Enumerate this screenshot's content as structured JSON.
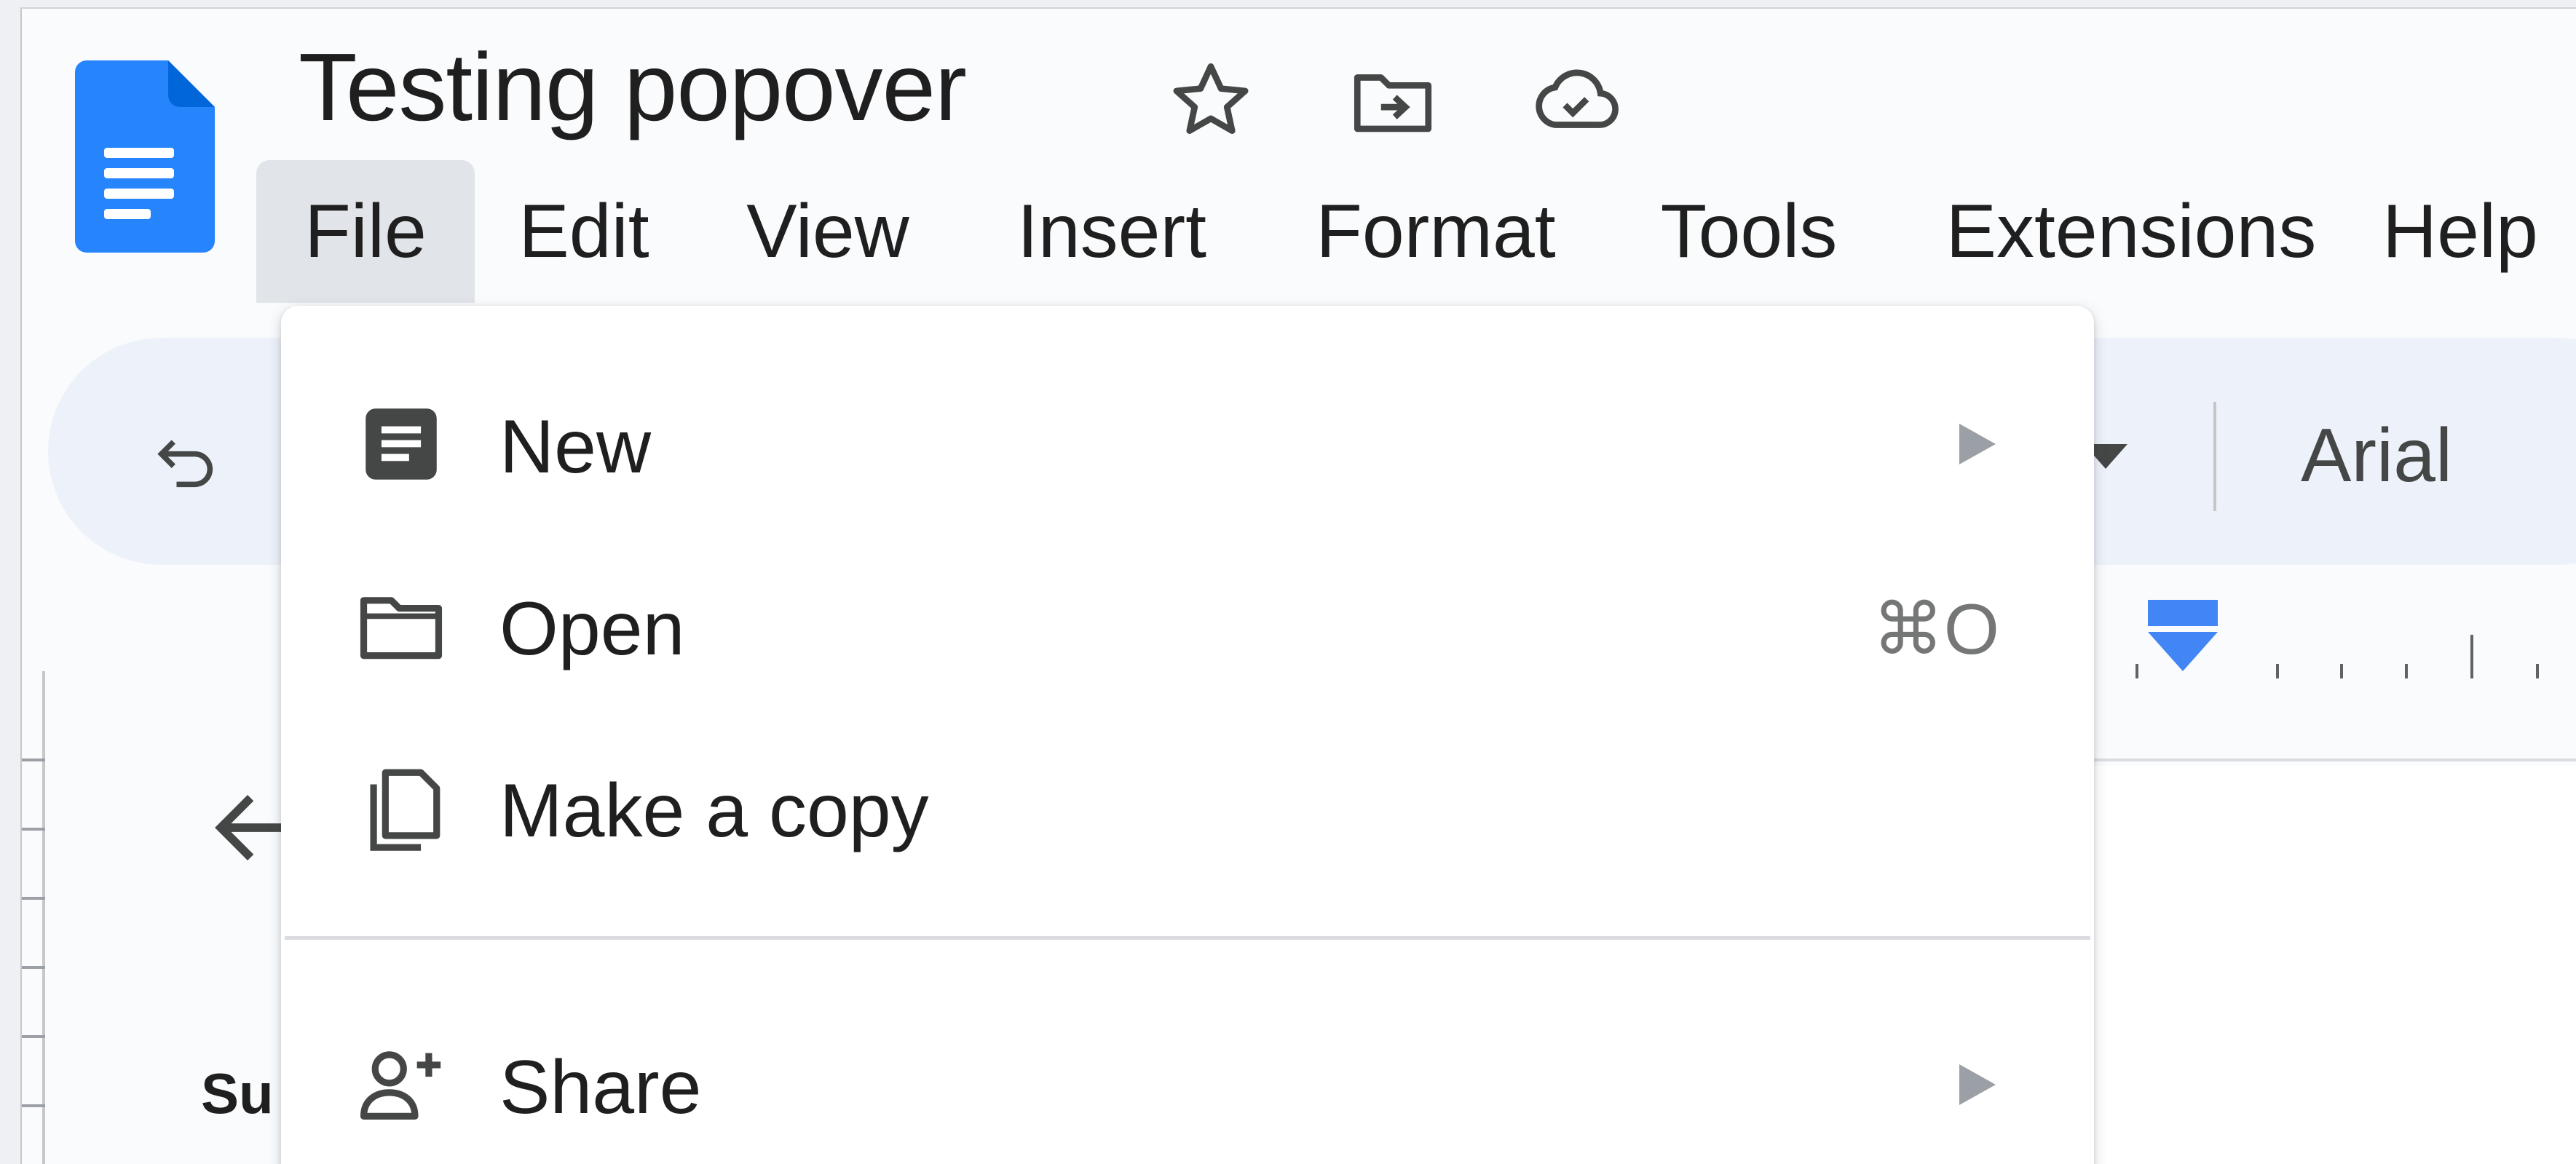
{
  "document": {
    "title": "Testing popover"
  },
  "title_icons": [
    "star-icon",
    "move-to-folder-icon",
    "cloud-saved-icon"
  ],
  "menubar": {
    "items": [
      {
        "label": "File",
        "active": true
      },
      {
        "label": "Edit"
      },
      {
        "label": "View"
      },
      {
        "label": "Insert"
      },
      {
        "label": "Format"
      },
      {
        "label": "Tools"
      },
      {
        "label": "Extensions"
      },
      {
        "label": "Help"
      }
    ]
  },
  "toolbar": {
    "font": "Arial"
  },
  "outline": {
    "text": "Su"
  },
  "file_menu": {
    "items": [
      {
        "label": "New",
        "icon": "new-document-icon",
        "submenu": true
      },
      {
        "label": "Open",
        "icon": "folder-icon",
        "shortcut": "⌘O"
      },
      {
        "label": "Make a copy",
        "icon": "copy-icon"
      },
      {
        "label": "Share",
        "icon": "share-person-add-icon",
        "submenu": true
      }
    ]
  },
  "colors": {
    "accent": "#4285f4",
    "doc_blue": "#2684fc",
    "menu_active_bg": "#e1e5ea",
    "toolbar_bg": "#edf2fa"
  }
}
